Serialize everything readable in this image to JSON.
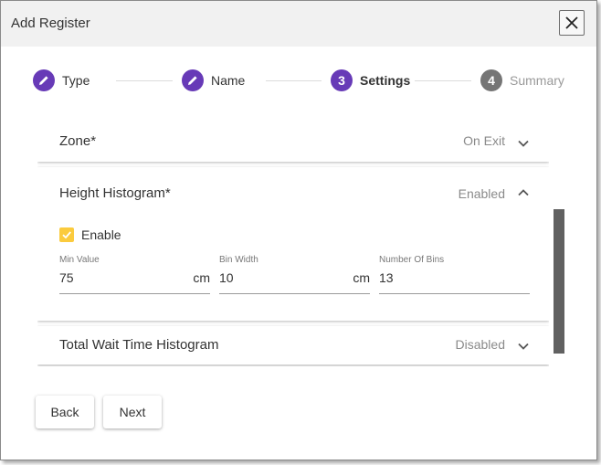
{
  "dialog": {
    "title": "Add Register",
    "close_icon": "close-icon"
  },
  "stepper": {
    "steps": [
      {
        "label": "Type",
        "marker": "",
        "icon": "pencil-icon",
        "state": "completed"
      },
      {
        "label": "Name",
        "marker": "",
        "icon": "pencil-icon",
        "state": "completed"
      },
      {
        "label": "Settings",
        "marker": "3",
        "icon": "",
        "state": "active"
      },
      {
        "label": "Summary",
        "marker": "4",
        "icon": "",
        "state": "upcoming"
      }
    ]
  },
  "panels": {
    "zone": {
      "title": "Zone*",
      "status": "On Exit",
      "expanded": false
    },
    "height_histogram": {
      "title": "Height Histogram*",
      "status": "Enabled",
      "expanded": true,
      "enable_label": "Enable",
      "enable_checked": true,
      "fields": [
        {
          "label": "Min Value",
          "value": "75",
          "unit": "cm"
        },
        {
          "label": "Bin Width",
          "value": "10",
          "unit": "cm"
        },
        {
          "label": "Number Of Bins",
          "value": "13",
          "unit": ""
        }
      ]
    },
    "total_wait": {
      "title": "Total Wait Time Histogram",
      "status": "Disabled",
      "expanded": false
    }
  },
  "buttons": {
    "back": "Back",
    "next": "Next"
  },
  "colors": {
    "step_active": "#673ab7",
    "step_upcoming": "#757575",
    "checkbox": "#fbcb3e",
    "scrollbar": "#616161"
  }
}
